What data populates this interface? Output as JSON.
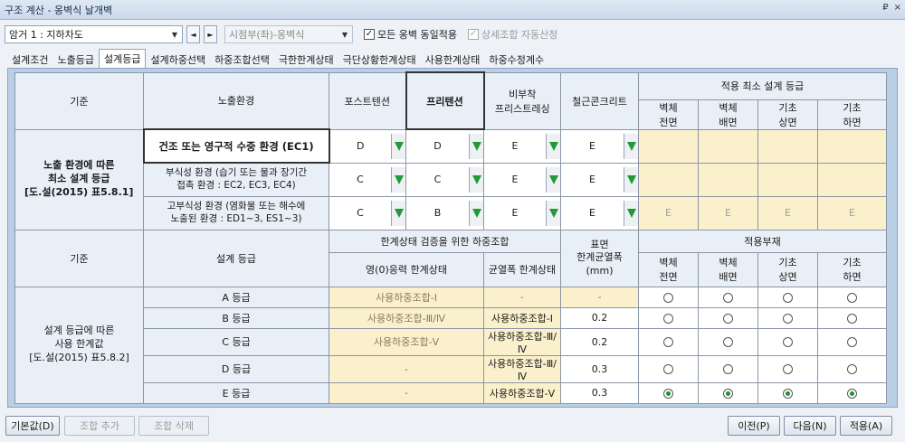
{
  "window": {
    "title": "구조 계산 - 옹벽식 날개벽",
    "pin": "₽",
    "close": "×"
  },
  "toolbar": {
    "combo_main": "암거 1 : 지하차도",
    "nav_prev": "◄",
    "nav_next": "►",
    "combo_side": "시점부(좌)-옹벽식",
    "check_all": {
      "label": "모든 옹벽 동일적용",
      "checked": true
    },
    "check_auto": {
      "label": "상세조합 자동산정",
      "checked": true
    }
  },
  "tabs": [
    "설계조건",
    "노출등급",
    "설계등급",
    "설계하중선택",
    "하중조합선택",
    "극한한계상태",
    "극단상황한계상태",
    "사용한계상태",
    "하중수정계수"
  ],
  "active_tab": 2,
  "top_table": {
    "h_criterion": "기준",
    "h_exposure": "노출환경",
    "h_cols": [
      "포스트텐션",
      "프리텐션",
      "비부착\n프리스트레싱",
      "철근콘크리트"
    ],
    "h_apply": "적용 최소 설계 등급",
    "h_parts": [
      "벽체\n전면",
      "벽체\n배면",
      "기초\n상면",
      "기초\n하면"
    ],
    "row_label": "노출 환경에 따른\n최소 설계 등급\n[도.설(2015) 표5.8.1]",
    "rows": [
      {
        "env": "건조 또는 영구적 수중 환경 (EC1)",
        "vals": [
          "D",
          "D",
          "E",
          "E"
        ],
        "apply": [
          "",
          "",
          "",
          ""
        ]
      },
      {
        "env": "부식성 환경 (습기 또는 물과 장기간\n접촉 환경 : EC2, EC3, EC4)",
        "vals": [
          "C",
          "C",
          "E",
          "E"
        ],
        "apply": [
          "",
          "",
          "",
          ""
        ]
      },
      {
        "env": "고부식성 환경 (염화물 또는 해수에\n노출된 환경 : ED1~3, ES1~3)",
        "vals": [
          "C",
          "B",
          "E",
          "E"
        ],
        "apply": [
          "E",
          "E",
          "E",
          "E"
        ]
      }
    ]
  },
  "bottom_table": {
    "h_criterion": "기준",
    "h_grade": "설계 등급",
    "h_combo": "한계상태 검증을 위한 하중조합",
    "h_sub": [
      "영(0)응력 한계상태",
      "균열폭 한계상태"
    ],
    "h_crack": "표면\n한계균열폭\n(mm)",
    "h_apply": "적용부재",
    "h_parts": [
      "벽체\n전면",
      "벽체\n배면",
      "기초\n상면",
      "기초\n하면"
    ],
    "row_label": "설계 등급에 따른\n사용 한계값\n[도.설(2015) 표5.8.2]",
    "rows": [
      {
        "grade": "A 등급",
        "zero": "사용하중조합-Ⅰ",
        "crack_combo": "-",
        "width": "-",
        "radios": [
          false,
          false,
          false,
          false
        ]
      },
      {
        "grade": "B 등급",
        "zero": "사용하중조합-Ⅲ/Ⅳ",
        "crack_combo": "사용하중조합-Ⅰ",
        "width": "0.2",
        "radios": [
          false,
          false,
          false,
          false
        ]
      },
      {
        "grade": "C 등급",
        "zero": "사용하중조합-Ⅴ",
        "crack_combo": "사용하중조합-Ⅲ/Ⅳ",
        "width": "0.2",
        "radios": [
          false,
          false,
          false,
          false
        ]
      },
      {
        "grade": "D 등급",
        "zero": "-",
        "crack_combo": "사용하중조합-Ⅲ/Ⅳ",
        "width": "0.3",
        "radios": [
          false,
          false,
          false,
          false
        ]
      },
      {
        "grade": "E 등급",
        "zero": "-",
        "crack_combo": "사용하중조합-Ⅴ",
        "width": "0.3",
        "radios": [
          true,
          true,
          true,
          true
        ]
      }
    ]
  },
  "buttons": {
    "default": "기본값(D)",
    "add_combo": "조합 추가",
    "del_combo": "조합 삭제",
    "prev": "이전(P)",
    "next": "다음(N)",
    "apply": "적용(A)"
  }
}
